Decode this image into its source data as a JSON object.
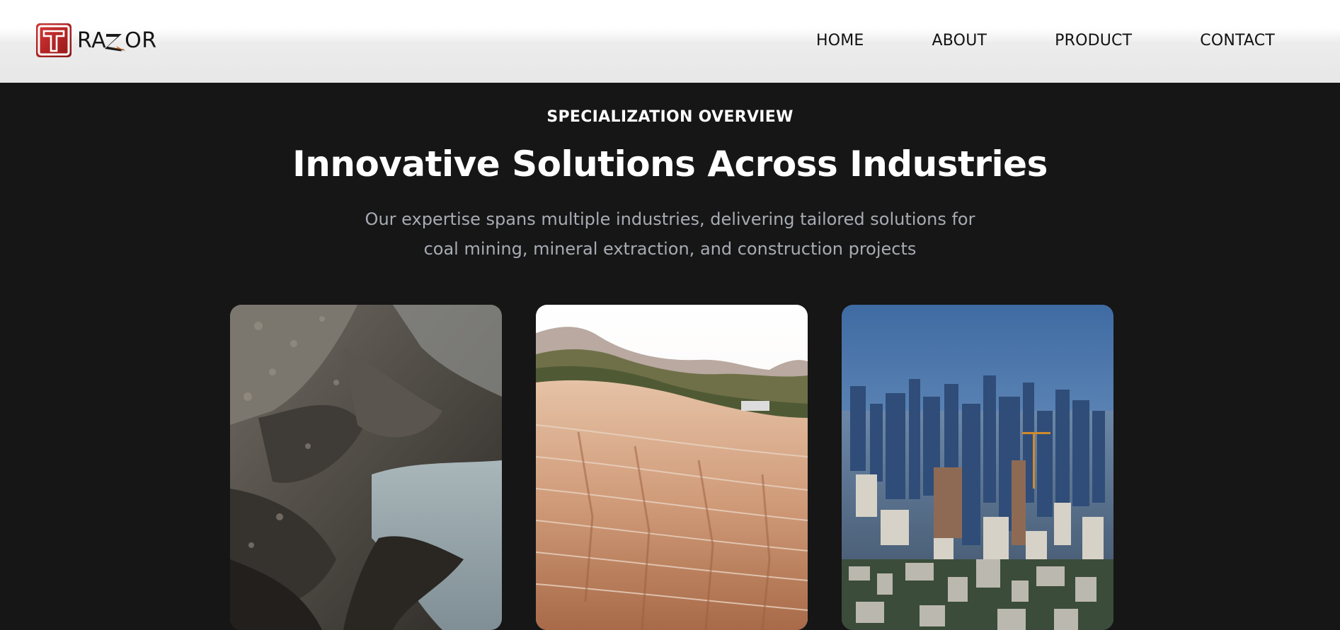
{
  "header": {
    "logo": {
      "letter": "T",
      "text_before": "RA",
      "text_after": "OR"
    },
    "nav": [
      {
        "label": "HOME"
      },
      {
        "label": "ABOUT"
      },
      {
        "label": "PRODUCT"
      },
      {
        "label": "CONTACT"
      }
    ]
  },
  "hero": {
    "eyebrow": "SPECIALIZATION OVERVIEW",
    "title": "Innovative Solutions Across Industries",
    "subtitle_line1": "Our expertise spans multiple industries, delivering tailored solutions for",
    "subtitle_line2": "coal mining, mineral extraction, and construction projects"
  },
  "cards": [
    {
      "image": "coal-mining-pit-photo"
    },
    {
      "image": "open-pit-mineral-mine-photo"
    },
    {
      "image": "city-skyline-construction-photo"
    }
  ],
  "colors": {
    "background": "#161616",
    "header_bg": "#e7e7e7",
    "logo_red": "#c62d2d",
    "bolt_orange": "#e0711c",
    "subtitle_gray": "#a7abb3"
  }
}
